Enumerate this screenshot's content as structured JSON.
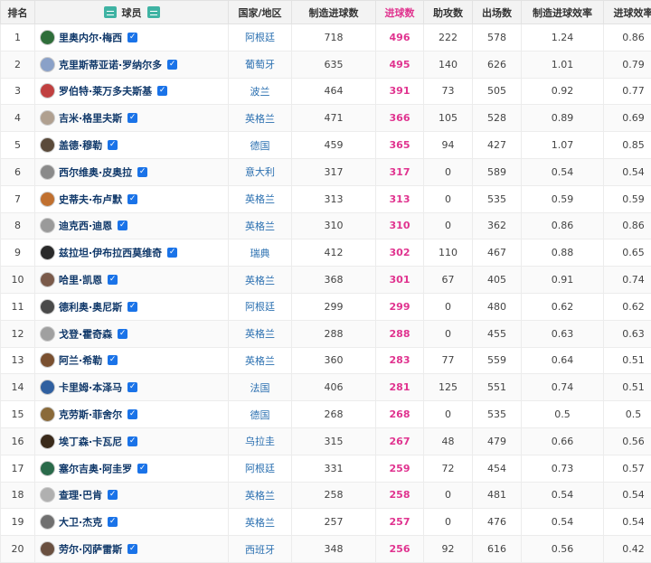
{
  "table": {
    "headers": {
      "rank": "排名",
      "player": "球员",
      "country": "国家/地区",
      "created_goals": "制造进球数",
      "goals": "进球数",
      "assists": "助攻数",
      "appearances": "出场数",
      "created_rate": "制造进球效率",
      "goal_rate": "进球效率"
    },
    "header_icons": [
      "list-icon",
      "list-icon"
    ],
    "rows": [
      {
        "rank": "1",
        "name": "里奥内尔·梅西",
        "country": "阿根廷",
        "created": "718",
        "goals": "496",
        "assists": "222",
        "apps": "578",
        "created_rate": "1.24",
        "goal_rate": "0.86"
      },
      {
        "rank": "2",
        "name": "克里斯蒂亚诺·罗纳尔多",
        "country": "葡萄牙",
        "created": "635",
        "goals": "495",
        "assists": "140",
        "apps": "626",
        "created_rate": "1.01",
        "goal_rate": "0.79"
      },
      {
        "rank": "3",
        "name": "罗伯特·莱万多夫斯基",
        "country": "波兰",
        "created": "464",
        "goals": "391",
        "assists": "73",
        "apps": "505",
        "created_rate": "0.92",
        "goal_rate": "0.77"
      },
      {
        "rank": "4",
        "name": "吉米·格里夫斯",
        "country": "英格兰",
        "created": "471",
        "goals": "366",
        "assists": "105",
        "apps": "528",
        "created_rate": "0.89",
        "goal_rate": "0.69"
      },
      {
        "rank": "5",
        "name": "盖德·穆勒",
        "country": "德国",
        "created": "459",
        "goals": "365",
        "assists": "94",
        "apps": "427",
        "created_rate": "1.07",
        "goal_rate": "0.85"
      },
      {
        "rank": "6",
        "name": "西尔维奥·皮奥拉",
        "country": "意大利",
        "created": "317",
        "goals": "317",
        "assists": "0",
        "apps": "589",
        "created_rate": "0.54",
        "goal_rate": "0.54"
      },
      {
        "rank": "7",
        "name": "史蒂夫·布卢默",
        "country": "英格兰",
        "created": "313",
        "goals": "313",
        "assists": "0",
        "apps": "535",
        "created_rate": "0.59",
        "goal_rate": "0.59"
      },
      {
        "rank": "8",
        "name": "迪克西·迪恩",
        "country": "英格兰",
        "created": "310",
        "goals": "310",
        "assists": "0",
        "apps": "362",
        "created_rate": "0.86",
        "goal_rate": "0.86"
      },
      {
        "rank": "9",
        "name": "兹拉坦·伊布拉西莫维奇",
        "country": "瑞典",
        "created": "412",
        "goals": "302",
        "assists": "110",
        "apps": "467",
        "created_rate": "0.88",
        "goal_rate": "0.65"
      },
      {
        "rank": "10",
        "name": "哈里·凯恩",
        "country": "英格兰",
        "created": "368",
        "goals": "301",
        "assists": "67",
        "apps": "405",
        "created_rate": "0.91",
        "goal_rate": "0.74"
      },
      {
        "rank": "11",
        "name": "德利奥·奥尼斯",
        "country": "阿根廷",
        "created": "299",
        "goals": "299",
        "assists": "0",
        "apps": "480",
        "created_rate": "0.62",
        "goal_rate": "0.62"
      },
      {
        "rank": "12",
        "name": "戈登·霍奇森",
        "country": "英格兰",
        "created": "288",
        "goals": "288",
        "assists": "0",
        "apps": "455",
        "created_rate": "0.63",
        "goal_rate": "0.63"
      },
      {
        "rank": "13",
        "name": "阿兰·希勒",
        "country": "英格兰",
        "created": "360",
        "goals": "283",
        "assists": "77",
        "apps": "559",
        "created_rate": "0.64",
        "goal_rate": "0.51"
      },
      {
        "rank": "14",
        "name": "卡里姆·本泽马",
        "country": "法国",
        "created": "406",
        "goals": "281",
        "assists": "125",
        "apps": "551",
        "created_rate": "0.74",
        "goal_rate": "0.51"
      },
      {
        "rank": "15",
        "name": "克劳斯·菲舍尔",
        "country": "德国",
        "created": "268",
        "goals": "268",
        "assists": "0",
        "apps": "535",
        "created_rate": "0.5",
        "goal_rate": "0.5"
      },
      {
        "rank": "16",
        "name": "埃丁森·卡瓦尼",
        "country": "乌拉圭",
        "created": "315",
        "goals": "267",
        "assists": "48",
        "apps": "479",
        "created_rate": "0.66",
        "goal_rate": "0.56"
      },
      {
        "rank": "17",
        "name": "塞尔吉奥·阿圭罗",
        "country": "阿根廷",
        "created": "331",
        "goals": "259",
        "assists": "72",
        "apps": "454",
        "created_rate": "0.73",
        "goal_rate": "0.57"
      },
      {
        "rank": "18",
        "name": "查理·巴肯",
        "country": "英格兰",
        "created": "258",
        "goals": "258",
        "assists": "0",
        "apps": "481",
        "created_rate": "0.54",
        "goal_rate": "0.54"
      },
      {
        "rank": "19",
        "name": "大卫·杰克",
        "country": "英格兰",
        "created": "257",
        "goals": "257",
        "assists": "0",
        "apps": "476",
        "created_rate": "0.54",
        "goal_rate": "0.54"
      },
      {
        "rank": "20",
        "name": "劳尔·冈萨雷斯",
        "country": "西班牙",
        "created": "348",
        "goals": "256",
        "assists": "92",
        "apps": "616",
        "created_rate": "0.56",
        "goal_rate": "0.42"
      }
    ],
    "avatar_colors": [
      "#2f6e3a",
      "#8aa1c8",
      "#c04040",
      "#b0a090",
      "#5a4a3a",
      "#8a8a8a",
      "#c07030",
      "#9a9a9a",
      "#2a2a2a",
      "#7a5a4a",
      "#4a4a4a",
      "#a0a0a0",
      "#7a5030",
      "#3060a0",
      "#8a6a3a",
      "#3a2a1a",
      "#2a6a4a",
      "#b0b0b0",
      "#707070",
      "#6a5040"
    ],
    "check_mark": "✓"
  }
}
